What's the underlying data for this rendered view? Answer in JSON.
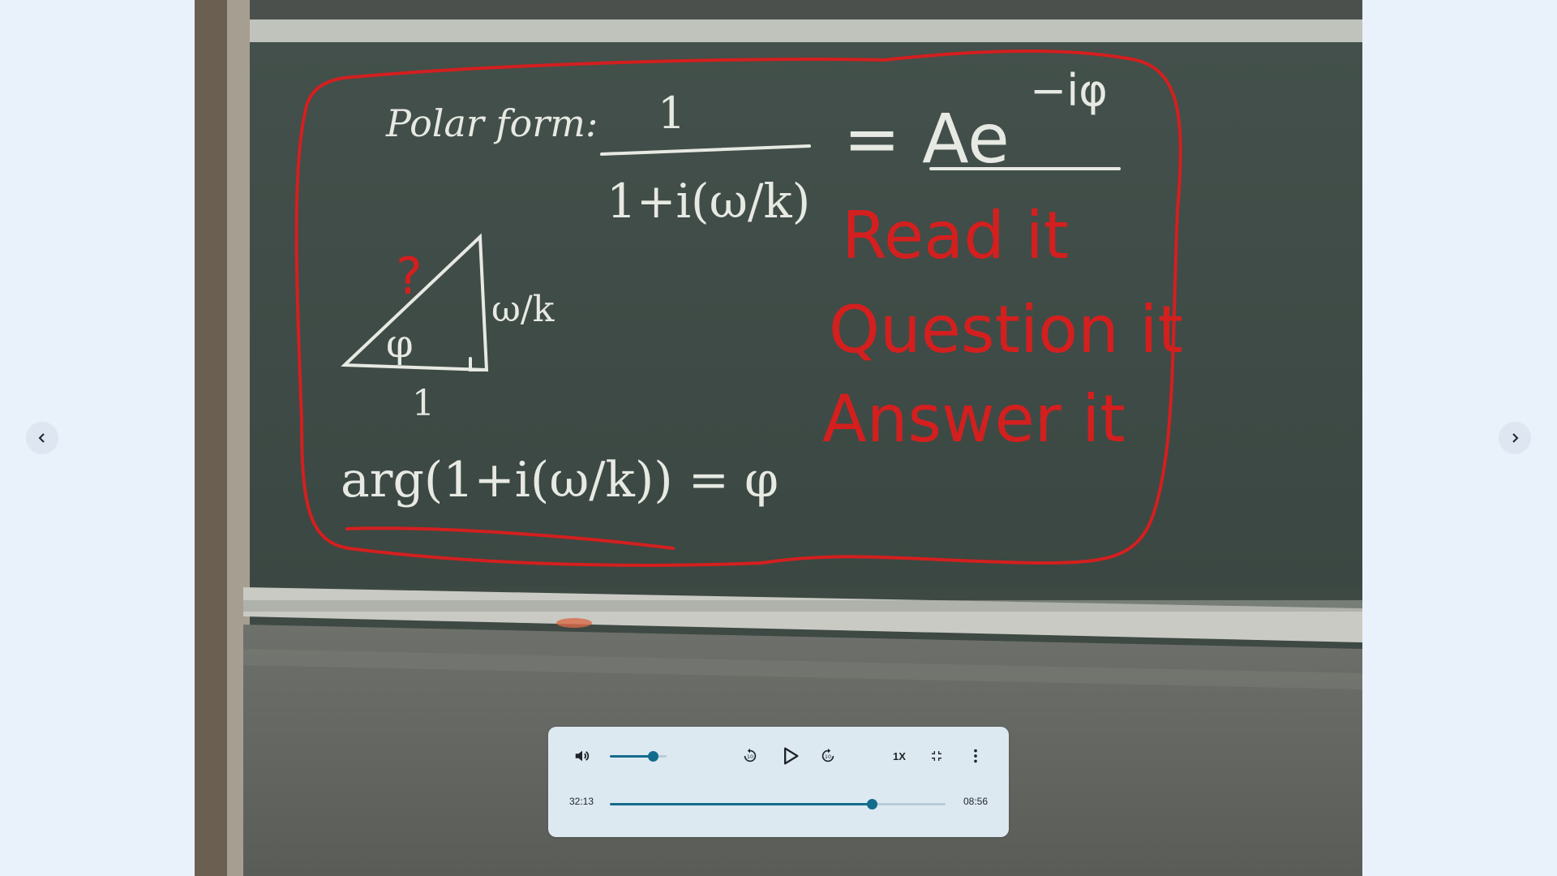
{
  "nav": {
    "prev_icon": "chevron-left-icon",
    "next_icon": "chevron-right-icon"
  },
  "board": {
    "chalk_polar_form": "Polar form:",
    "chalk_numerator": "1",
    "chalk_denominator": "1+i(ω/k)",
    "chalk_equals_A": "= Ae",
    "chalk_exponent": "−iφ",
    "chalk_side_label": "ω/k",
    "chalk_base_label": "1",
    "chalk_angle": "φ",
    "chalk_arg_equation": "arg(1+i(ω/k)) = φ",
    "annotation_question_mark": "?",
    "annotation_line1": "Read it",
    "annotation_line2": "Question it",
    "annotation_line3": "Answer it",
    "annotation_color": "#d41f1f"
  },
  "player": {
    "volume_icon": "volume-icon",
    "volume_level": 0.75,
    "rewind_icon": "rewind-10-icon",
    "play_icon": "play-icon",
    "forward_icon": "forward-10-icon",
    "speed_label": "1X",
    "exit_fullscreen_icon": "exit-fullscreen-icon",
    "more_icon": "more-vert-icon",
    "current_time": "32:13",
    "total_time": "08:56",
    "progress": 0.78,
    "accent_color": "#146c8c"
  }
}
